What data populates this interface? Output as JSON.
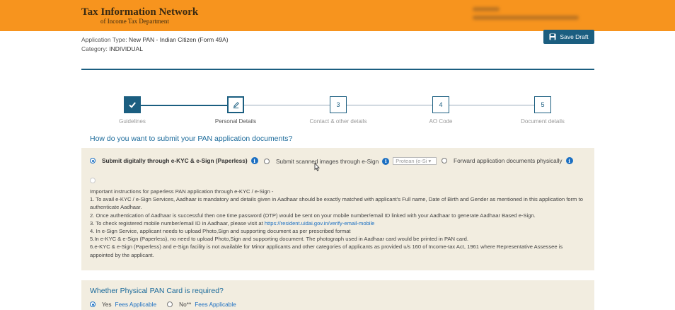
{
  "header": {
    "logo_title": "Tax Information Network",
    "logo_subtitle": "of Income Tax Department",
    "bg_color": "#f7941e"
  },
  "application": {
    "type_label": "Application Type:",
    "type_value": "New PAN - Indian Citizen (Form 49A)",
    "category_label": "Category:",
    "category_value": "INDIVIDUAL"
  },
  "toolbar": {
    "save_draft_label": "Save Draft",
    "save_icon": "floppy-disk-icon"
  },
  "stepper": {
    "steps": [
      {
        "label": "Guidelines",
        "marker": "✓",
        "state": "done"
      },
      {
        "label": "Personal Details",
        "marker": "✎",
        "state": "active"
      },
      {
        "label": "Contact & other details",
        "marker": "3",
        "state": "pending"
      },
      {
        "label": "AO Code",
        "marker": "4",
        "state": "pending"
      },
      {
        "label": "Document details",
        "marker": "5",
        "state": "pending"
      }
    ]
  },
  "submission": {
    "question": "How do you want to submit your PAN application documents?",
    "options": [
      {
        "label": "Submit digitally through e-KYC & e-Sign (Paperless)",
        "selected": true
      },
      {
        "label": "Submit scanned images through e-Sign",
        "selected": false,
        "dropdown_value": "Protean (e-Si"
      },
      {
        "label": "Forward application documents physically",
        "selected": false
      }
    ],
    "instructions": {
      "heading": "Important instructions for paperless PAN application through e-KYC / e-Sign -",
      "items": [
        "1. To avail e-KYC / e-Sign Services, Aadhaar is mandatory and details given in Aadhaar should be exactly matched with applicant's Full name, Date of Birth and Gender as mentioned in this application form to authenticate Aadhaar.",
        "2. Once authentication of Aadhaar is successful then one time password (OTP) would be sent on your mobile number/email ID linked with your Aadhaar to generate Aadhaar Based e-Sign.",
        "3. To check registered mobile number/email ID in Aadhaar, please visit at",
        "4. In e-Sign Service, applicant needs to upload Photo,Sign and supporting document as per prescribed format",
        "5.In e-KYC & e-Sign (Paperless), no need to upload Photo,Sign and supporting document. The photograph used in Aadhaar card would be printed in PAN card.",
        "6.e-KYC & e-Sign (Paperless) and e-Sign facility is not available for Minor applicants and other categories of applicants as provided u/s 160 of Income-tax Act, 1961 where Representative Assessee is appointed by the applicant."
      ],
      "link": "https://resident.uidai.gov.in/verify-email-mobile"
    }
  },
  "physical_card": {
    "question": "Whether Physical PAN Card is required?",
    "yes_label": "Yes",
    "yes_fees": "Fees Applicable",
    "no_label": "No**",
    "no_fees": "Fees Applicable",
    "selected": "yes"
  },
  "colors": {
    "accent": "#1b5e80",
    "link": "#1b6fc2",
    "panel_bg": "#f2ede0"
  }
}
